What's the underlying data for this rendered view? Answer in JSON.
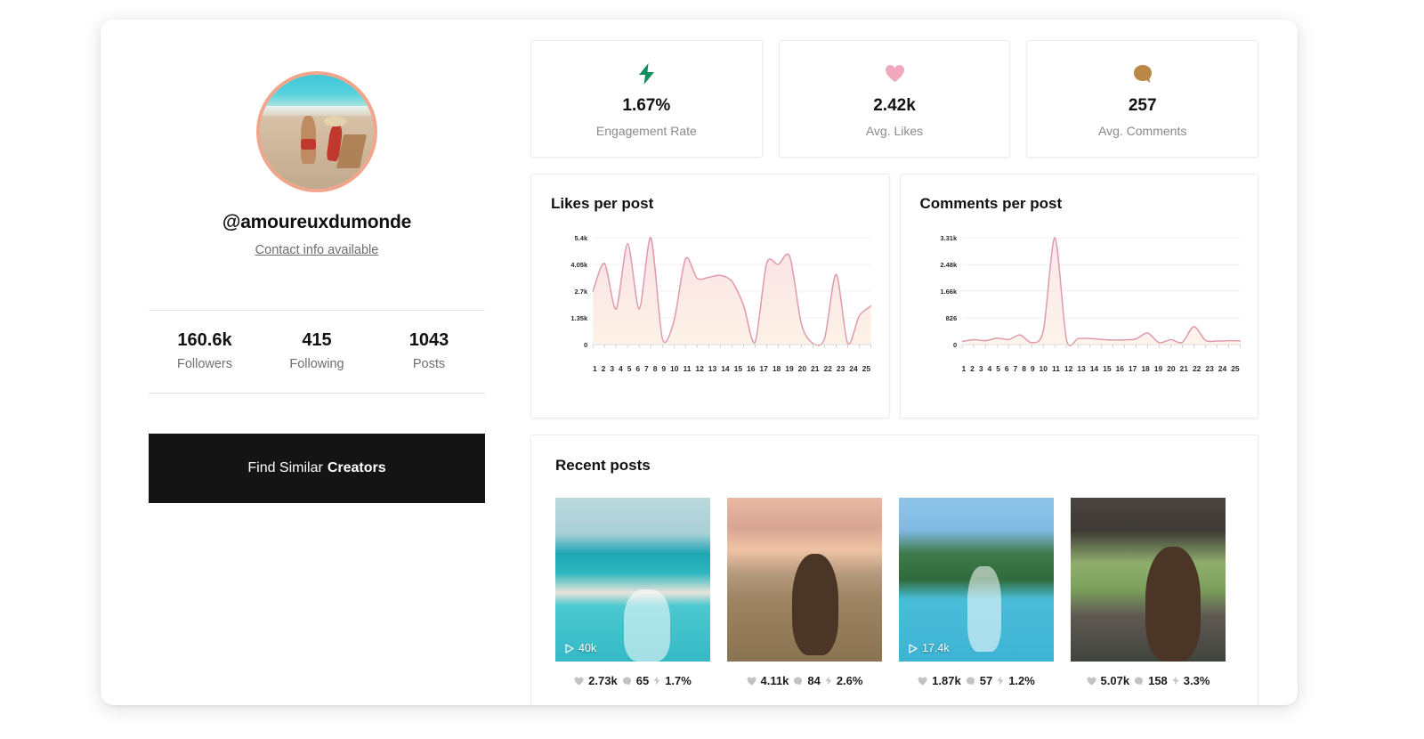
{
  "profile": {
    "handle": "@amoureuxdumonde",
    "contact_link": "Contact info available",
    "avatar_alt": "profile-photo-beach",
    "stats": [
      {
        "value": "160.6k",
        "label": "Followers"
      },
      {
        "value": "415",
        "label": "Following"
      },
      {
        "value": "1043",
        "label": "Posts"
      }
    ],
    "cta_regular": "Find Similar",
    "cta_bold": "Creators"
  },
  "kpis": [
    {
      "icon": "lightning-bolt-icon",
      "value": "1.67%",
      "caption": "Engagement Rate",
      "color": "#0f8f5e"
    },
    {
      "icon": "heart-icon",
      "value": "2.42k",
      "caption": "Avg. Likes",
      "color": "#f0a8bc"
    },
    {
      "icon": "comment-bubble-icon",
      "value": "257",
      "caption": "Avg. Comments",
      "color": "#b98844"
    }
  ],
  "chart_data": [
    {
      "type": "area",
      "title": "Likes per post",
      "xlabel": "",
      "ylabel": "",
      "categories": [
        "1",
        "2",
        "3",
        "4",
        "5",
        "6",
        "7",
        "8",
        "9",
        "10",
        "11",
        "12",
        "13",
        "14",
        "15",
        "16",
        "17",
        "18",
        "19",
        "20",
        "21",
        "22",
        "23",
        "24",
        "25"
      ],
      "ytick_labels": [
        "0",
        "1.35k",
        "2.7k",
        "4.05k",
        "5.4k"
      ],
      "ytick_values": [
        0,
        1350,
        2700,
        4050,
        5400
      ],
      "ylim": [
        0,
        5400
      ],
      "grid": true,
      "legend": "none",
      "line_color": "#e09aad",
      "fill_top": "#f7dde2",
      "fill_bottom": "#fdf0e2",
      "values": [
        2700,
        4100,
        1800,
        5100,
        1800,
        5400,
        300,
        1200,
        4350,
        3350,
        3400,
        3500,
        3200,
        2000,
        120,
        4100,
        4050,
        4450,
        1050,
        60,
        300,
        3550,
        60,
        1450,
        1950
      ]
    },
    {
      "type": "area",
      "title": "Comments per post",
      "xlabel": "",
      "ylabel": "",
      "categories": [
        "1",
        "2",
        "3",
        "4",
        "5",
        "6",
        "7",
        "8",
        "9",
        "10",
        "11",
        "12",
        "13",
        "14",
        "15",
        "16",
        "17",
        "18",
        "19",
        "20",
        "21",
        "22",
        "23",
        "24",
        "25"
      ],
      "ytick_labels": [
        "0",
        "826",
        "1.66k",
        "2.48k",
        "3.31k"
      ],
      "ytick_values": [
        0,
        826,
        1660,
        2480,
        3310
      ],
      "ylim": [
        0,
        3310
      ],
      "grid": true,
      "legend": "none",
      "line_color": "#e09aad",
      "fill_top": "#f9e4e6",
      "fill_bottom": "#fdf2e6",
      "values": [
        95,
        150,
        120,
        200,
        155,
        300,
        60,
        430,
        3310,
        150,
        185,
        190,
        160,
        140,
        145,
        175,
        360,
        60,
        150,
        70,
        560,
        130,
        110,
        120,
        115
      ]
    }
  ],
  "recent": {
    "title": "Recent posts",
    "posts": [
      {
        "thumb": "beach-sea-woman",
        "play_count": "40k",
        "likes": "2.73k",
        "comments": "65",
        "engagement": "1.7%"
      },
      {
        "thumb": "sunset-field-woman",
        "play_count": null,
        "likes": "4.11k",
        "comments": "84",
        "engagement": "2.6%"
      },
      {
        "thumb": "pool-palms-woman",
        "play_count": "17.4k",
        "likes": "1.87k",
        "comments": "57",
        "engagement": "1.2%"
      },
      {
        "thumb": "safari-jeep-woman",
        "play_count": null,
        "likes": "5.07k",
        "comments": "158",
        "engagement": "3.3%"
      }
    ]
  }
}
